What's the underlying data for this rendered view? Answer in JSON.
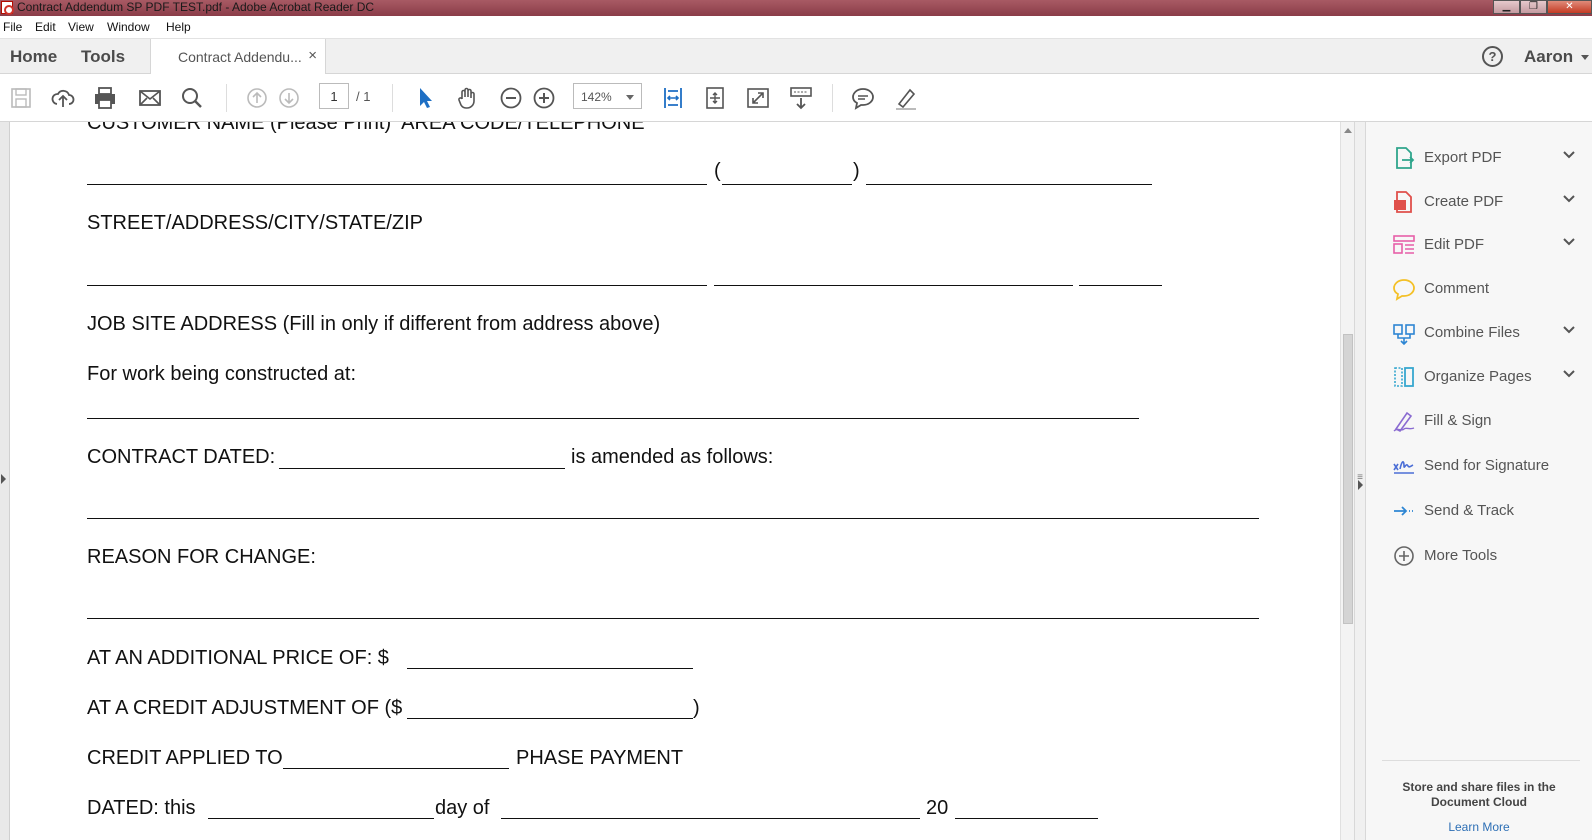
{
  "window": {
    "title": "Contract Addendum SP PDF TEST.pdf - Adobe Acrobat Reader DC",
    "min": "▁",
    "max": "❐",
    "close": "✕"
  },
  "menu": [
    "File",
    "Edit",
    "View",
    "Window",
    "Help"
  ],
  "tabs": {
    "home": "Home",
    "tools": "Tools",
    "document": "Contract Addendu...",
    "close": "×",
    "help": "?",
    "user": "Aaron"
  },
  "toolbar": {
    "page_current": "1",
    "page_total": "/ 1",
    "zoom": "142%"
  },
  "document": {
    "customer_heading": "CUSTOMER NAME (Please Print)  AREA CODE/TELEPHONE",
    "phone_open": "(",
    "phone_close": ")",
    "street_heading": "STREET/ADDRESS/CITY/STATE/ZIP",
    "job_site_heading": "JOB SITE ADDRESS (Fill in only if different from address above)",
    "work_at": "For work being constructed at:",
    "contract_dated": "CONTRACT DATED:",
    "amended": "is amended as follows:",
    "reason": "REASON FOR CHANGE:",
    "additional_price": "AT AN ADDITIONAL PRICE OF: $",
    "credit_adjustment": "AT A CREDIT ADJUSTMENT OF ($",
    "credit_close": ")",
    "credit_applied": "CREDIT APPLIED TO",
    "phase_payment": "PHASE PAYMENT",
    "dated_this": "DATED: this",
    "day_of": "day of",
    "year_prefix": "20"
  },
  "right_pane": {
    "tools": [
      {
        "label": "Export PDF",
        "icon": "export-pdf-icon",
        "color": "#2fa58c",
        "expandable": true
      },
      {
        "label": "Create PDF",
        "icon": "create-pdf-icon",
        "color": "#e0504b",
        "expandable": true
      },
      {
        "label": "Edit PDF",
        "icon": "edit-pdf-icon",
        "color": "#e65fa8",
        "expandable": true
      },
      {
        "label": "Comment",
        "icon": "comment-icon",
        "color": "#f4c026",
        "expandable": false
      },
      {
        "label": "Combine Files",
        "icon": "combine-files-icon",
        "color": "#2e86d3",
        "expandable": true
      },
      {
        "label": "Organize Pages",
        "icon": "organize-pages-icon",
        "color": "#37a7cf",
        "expandable": true
      },
      {
        "label": "Fill & Sign",
        "icon": "fill-sign-icon",
        "color": "#8a6bd1",
        "expandable": false
      },
      {
        "label": "Send for Signature",
        "icon": "send-signature-icon",
        "color": "#4b6ed6",
        "expandable": false
      },
      {
        "label": "Send & Track",
        "icon": "send-track-icon",
        "color": "#2e86d3",
        "expandable": false
      },
      {
        "label": "More Tools",
        "icon": "more-tools-icon",
        "color": "#666666",
        "expandable": false
      }
    ],
    "cloud_text": "Store and share files in the Document Cloud",
    "learn_more": "Learn More"
  }
}
